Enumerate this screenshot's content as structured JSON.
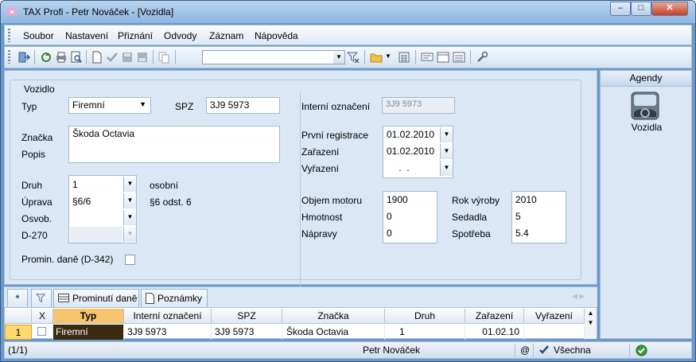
{
  "window": {
    "title": "TAX Profi - Petr Nováček - [Vozidla]",
    "buttons": {
      "minimize": "–",
      "maximize": "□",
      "close": "✕"
    }
  },
  "menu": [
    "Soubor",
    "Nastavení",
    "Přiznání",
    "Odvody",
    "Záznam",
    "Nápověda"
  ],
  "toolbar": {
    "combo_value": ""
  },
  "form": {
    "group_title": "Vozidlo",
    "typ_label": "Typ",
    "typ_value": "Firemní",
    "spz_label": "SPZ",
    "spz_value": "3J9 5973",
    "znacka_label": "Značka",
    "popis_label": "Popis",
    "znacka_value": "Škoda Octavia",
    "druh_label": "Druh",
    "druh_value": "1",
    "druh_text": "osobní",
    "uprava_label": "Úprava",
    "uprava_value": "§6/6",
    "uprava_text": "§6 odst. 6",
    "osvob_label": "Osvob.",
    "osvob_value": "",
    "d270_label": "D-270",
    "d270_value": "",
    "promin_label": "Promin. daně (D-342)",
    "interni_label": "Interní označení",
    "interni_value": "3J9 5973",
    "prvni_reg_label": "První registrace",
    "prvni_reg_value": "01.02.2010",
    "zarazeni_label": "Zařazení",
    "zarazeni_value": "01.02.2010",
    "vyrazeni_label": "Vyřazení",
    "vyrazeni_value": " .  .",
    "objem_label": "Objem motoru",
    "objem_value": "1900",
    "hmotnost_label": "Hmotnost",
    "hmotnost_value": "0",
    "napravy_label": "Nápravy",
    "napravy_value": "0",
    "rok_label": "Rok výroby",
    "rok_value": "2010",
    "sedadla_label": "Sedadla",
    "sedadla_value": "5",
    "spotreba_label": "Spotřeba",
    "spotreba_value": "5.4"
  },
  "sidepanel": {
    "title": "Agendy",
    "item_label": "Vozidla"
  },
  "tabs": {
    "first": "*",
    "prominuti": "Prominutí daně",
    "poznamky": "Poznámky"
  },
  "grid": {
    "headers": [
      "X",
      "Typ",
      "Interní označení",
      "SPZ",
      "Značka",
      "Druh",
      "Zařazení",
      "Vyřazení"
    ],
    "row": {
      "num": "1",
      "typ": "Firemní",
      "interni": "3J9 5973",
      "spz": "3J9 5973",
      "znacka": "Škoda Octavia",
      "druh": "1",
      "zarazeni": "01.02.10",
      "vyrazeni": ""
    }
  },
  "status": {
    "count": "(1/1)",
    "user": "Petr Nováček",
    "at": "@",
    "filter": "Všechna"
  },
  "colors": {
    "selected_cell": "#3a2a10",
    "row_number": "#ffd970",
    "header_active": "#f7c46c"
  }
}
